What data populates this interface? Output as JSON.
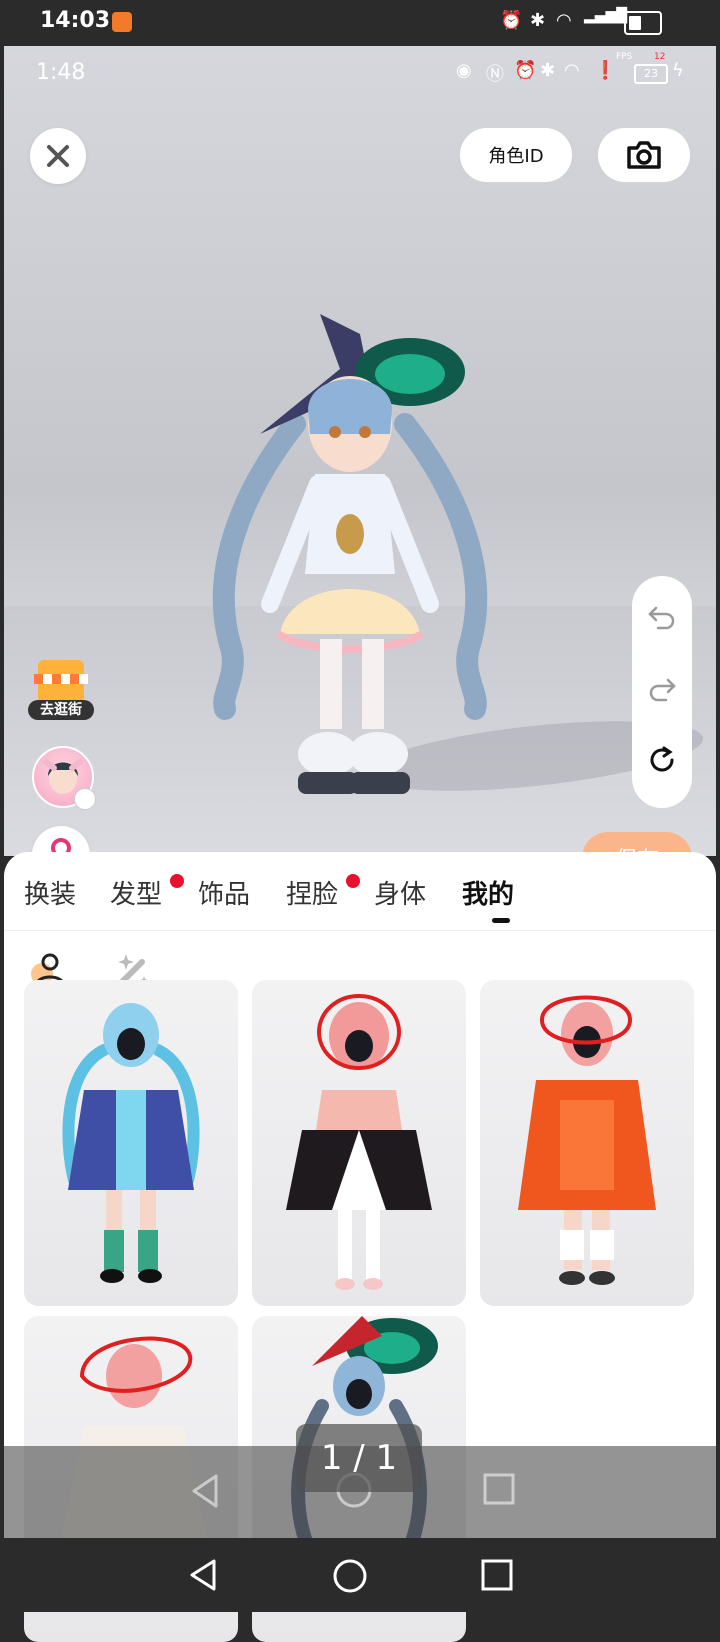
{
  "status_bar": {
    "time": "14:03",
    "icons": [
      "alarm-icon",
      "bluetooth-icon",
      "wifi-icon",
      "signal-5g-icon",
      "battery-icon"
    ]
  },
  "game_status": {
    "time": "1:48",
    "fps_label": "FPS",
    "fps_value": "12",
    "battery_value": "23",
    "icons": [
      "eye-icon",
      "nfc-icon",
      "alarm-icon",
      "bluetooth-icon",
      "wifi-icon",
      "alert-icon",
      "battery-icon",
      "charging-icon"
    ]
  },
  "header": {
    "role_id_label": "角色ID"
  },
  "sidebar": {
    "shop_label": "去逛街"
  },
  "actions": {
    "save_label": "保存"
  },
  "tabs": [
    {
      "label": "换装",
      "dot": false
    },
    {
      "label": "发型",
      "dot": true
    },
    {
      "label": "饰品",
      "dot": false
    },
    {
      "label": "捏脸",
      "dot": true
    },
    {
      "label": "身体",
      "dot": false
    },
    {
      "label": "我的",
      "dot": false,
      "active": true
    }
  ],
  "outfits": [
    {
      "name": "outfit-blue-hoodie",
      "accent": "#3f4fa6",
      "hair": "#68c3e6"
    },
    {
      "name": "outfit-black-white-dress",
      "accent": "#1e1a1e",
      "hair": "#f29a9a"
    },
    {
      "name": "outfit-orange-coat",
      "accent": "#f0571f",
      "hair": "#f2a0a0"
    },
    {
      "name": "outfit-white-dress",
      "accent": "#f4efe8",
      "hair": "#f2a0a0"
    },
    {
      "name": "outfit-witch-hat",
      "accent": "#5f6f86",
      "hair": "#8fb6d8"
    }
  ],
  "gallery": {
    "counter": "1 / 1"
  },
  "colors": {
    "save_button": "#fbb58a",
    "notification_dot": "#e8112d",
    "gender_badge": "#3b82f6",
    "annotation_red": "#e02020"
  }
}
